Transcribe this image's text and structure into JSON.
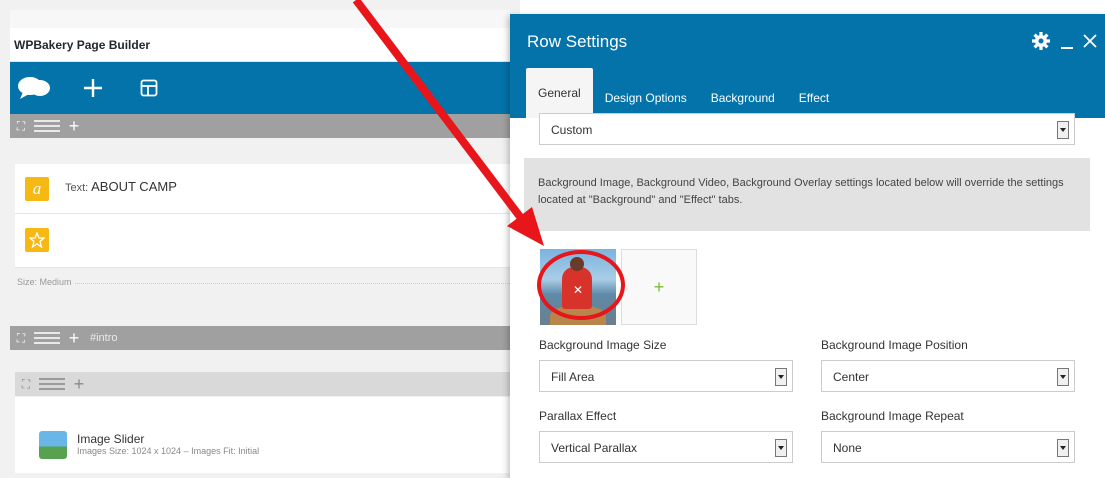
{
  "builder": {
    "title": "WPBakery Page Builder",
    "text_element": {
      "label": "Text:",
      "value": "ABOUT CAMP"
    },
    "size": {
      "label": "Size:",
      "value": "Medium"
    },
    "row_label": "#intro",
    "slider": {
      "title": "Image Slider",
      "meta": "Images Size: 1024 x 1024 – Images Fit: Initial"
    }
  },
  "panel": {
    "title": "Row Settings",
    "tabs": [
      {
        "label": "General"
      },
      {
        "label": "Design Options"
      },
      {
        "label": "Background"
      },
      {
        "label": "Effect"
      }
    ],
    "top_select": "Custom",
    "notice": "Background Image, Background Video, Background Overlay settings located below will override the settings located at \"Background\" and \"Effect\" tabs.",
    "add_image": "+",
    "fields": {
      "bg_size": {
        "label": "Background Image Size",
        "value": "Fill Area"
      },
      "bg_position": {
        "label": "Background Image Position",
        "value": "Center"
      },
      "parallax": {
        "label": "Parallax Effect",
        "value": "Vertical Parallax"
      },
      "bg_repeat": {
        "label": "Background Image Repeat",
        "value": "None"
      }
    }
  },
  "colors": {
    "brand_blue": "#0473aa",
    "annotation_red": "#e8151a",
    "element_yellow": "#f6b914",
    "add_green": "#7cbc36"
  }
}
